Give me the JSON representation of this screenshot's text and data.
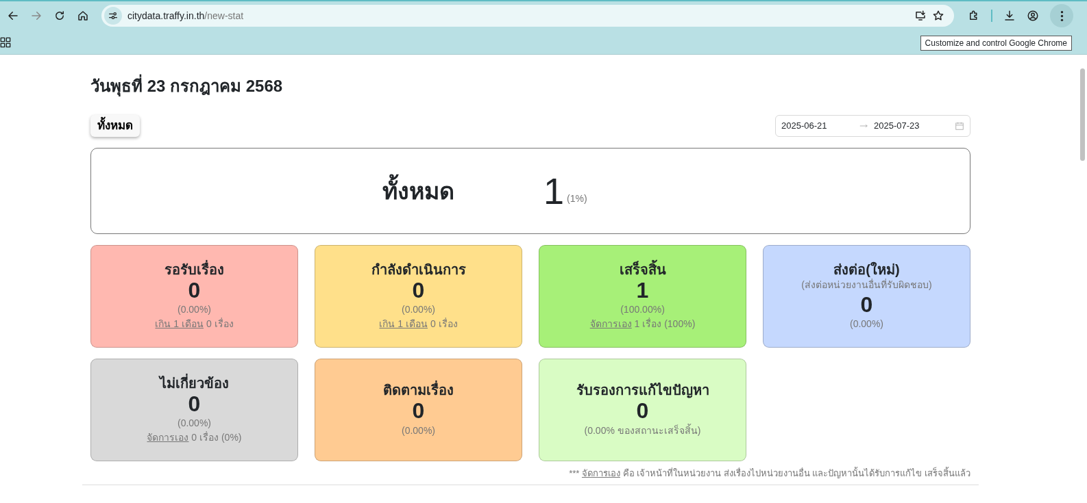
{
  "browser": {
    "url_host": "citydata.traffy.in.th",
    "url_path": "/new-stat",
    "tooltip": "Customize and control Google Chrome"
  },
  "page": {
    "date_heading": "วันพุธที่ 23 กรกฎาคม 2568",
    "filter_button": "ทั้งหมด",
    "date_range": {
      "start": "2025-06-21",
      "end": "2025-07-23"
    }
  },
  "summary": {
    "label": "ทั้งหมด",
    "count": "1",
    "percent": "(1%)"
  },
  "cards": [
    {
      "title": "รอรับเรื่อง",
      "count": "0",
      "percent": "(0.00%)",
      "note": {
        "link": "เกิน 1 เดือน",
        "text": " 0 เรื่อง"
      },
      "color": "#ffb8b0"
    },
    {
      "title": "กำลังดำเนินการ",
      "count": "0",
      "percent": "(0.00%)",
      "note": {
        "link": "เกิน 1 เดือน",
        "text": " 0 เรื่อง"
      },
      "color": "#ffe08a"
    },
    {
      "title": "เสร็จสิ้น",
      "count": "1",
      "percent": "(100.00%)",
      "note": {
        "link": "จัดการเอง",
        "text": " 1 เรื่อง (100%)"
      },
      "color": "#a7f078"
    },
    {
      "title": "ส่งต่อ(ใหม่)",
      "subtitle": "(ส่งต่อหน่วยงานอื่นที่รับผิดชอบ)",
      "count": "0",
      "percent": "(0.00%)",
      "color": "#c5d8fe"
    },
    {
      "title": "ไม่เกี่ยวข้อง",
      "count": "0",
      "percent": "(0.00%)",
      "note": {
        "link": "จัดการเอง",
        "text": " 0 เรื่อง (0%)"
      },
      "color": "#d9d9d9"
    },
    {
      "title": "ติดตามเรื่อง",
      "count": "0",
      "percent": "(0.00%)",
      "color": "#ffcb92"
    },
    {
      "title": "รับรองการแก้ไขปัญหา",
      "count": "0",
      "percent": "(0.00% ของสถานะเสร็จสิ้น)",
      "color": "#d9fcc4"
    }
  ],
  "footnote": {
    "prefix": "*** ",
    "link": "จัดการเอง",
    "text": " คือ เจ้าหน้าที่ในหน่วยงาน ส่งเรื่องไปหน่วยงานอื่น และปัญหานั้นได้รับการแก้ไข เสร็จสิ้นแล้ว"
  }
}
